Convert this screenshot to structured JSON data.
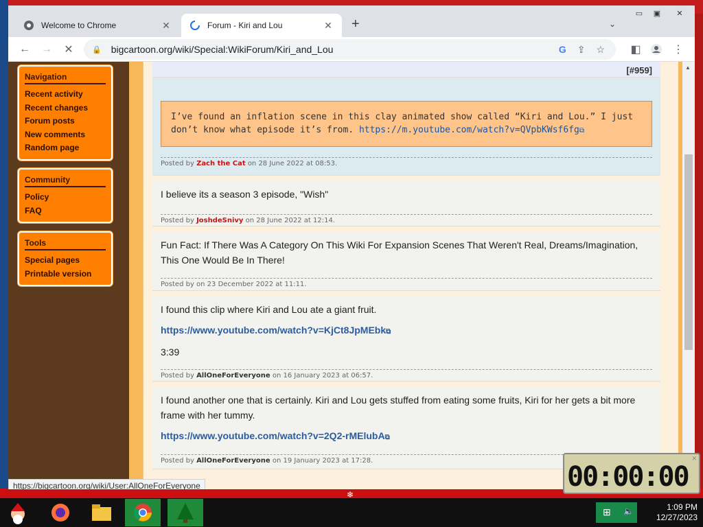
{
  "browser": {
    "tabs": [
      {
        "label": "Welcome to Chrome",
        "active": false
      },
      {
        "label": "Forum - Kiri and Lou",
        "active": true
      }
    ],
    "url": "bigcartoon.org/wiki/Special:WikiForum/Kiri_and_Lou",
    "status_url": "https://bigcartoon.org/wiki/User:AllOneForEveryone"
  },
  "sidebar": {
    "navigation": {
      "title": "Navigation",
      "items": [
        "Recent activity",
        "Recent changes",
        "Forum posts",
        "New comments",
        "Random page"
      ]
    },
    "community": {
      "title": "Community",
      "items": [
        "Policy",
        "FAQ"
      ]
    },
    "tools": {
      "title": "Tools",
      "items": [
        "Special pages",
        "Printable version"
      ]
    }
  },
  "forum": {
    "post_number": "[#959]",
    "posts": [
      {
        "quote_text": "I’ve found an inflation scene in this clay animated show called “Kiri and Lou.” I just don’t know what episode it’s from.",
        "quote_link": "https://m.youtube.com/watch?v=QVpbKWsf6fg",
        "meta_prefix": "Posted by",
        "author": "Zach the Cat",
        "date": "on 28 June 2022 at 08:53."
      },
      {
        "text": "I believe its a season 3 episode, \"Wish\"",
        "meta_prefix": "Posted by",
        "author": "JoshdeSnivy",
        "date": "on 28 June 2022 at 12:14."
      },
      {
        "text": "Fun Fact: If There Was A Category On This Wiki For Expansion Scenes That Weren't Real, Dreams/Imagination, This One Would Be In There!",
        "meta": "Posted by on 23 December 2022 at 11:11."
      },
      {
        "text": "I found this clip where Kiri and Lou ate a giant fruit.",
        "link": "https://www.youtube.com/watch?v=KjCt8JpMEbk",
        "timestamp": "3:39",
        "meta_prefix": "Posted by",
        "author": "AllOneForEveryone",
        "date": "on 16 January 2023 at 06:57."
      },
      {
        "text": "I found another one that is certainly. Kiri and Lou gets stuffed from eating some fruits, Kiri for her gets a bit more frame with her tummy.",
        "link": "https://www.youtube.com/watch?v=2Q2-rMElubA",
        "meta_prefix": "Posted by",
        "author": "AllOneForEveryone",
        "date": "on 19 January 2023 at 17:28."
      }
    ]
  },
  "timer": {
    "display": "00:00:00"
  },
  "clock": {
    "time": "1:09 PM",
    "date": "12/27/2023"
  },
  "colors": {
    "sidebar_box": "#ff8000",
    "quote_bg": "#ffc48a",
    "author_red": "#c81414",
    "link_blue": "#2a5d9f"
  }
}
